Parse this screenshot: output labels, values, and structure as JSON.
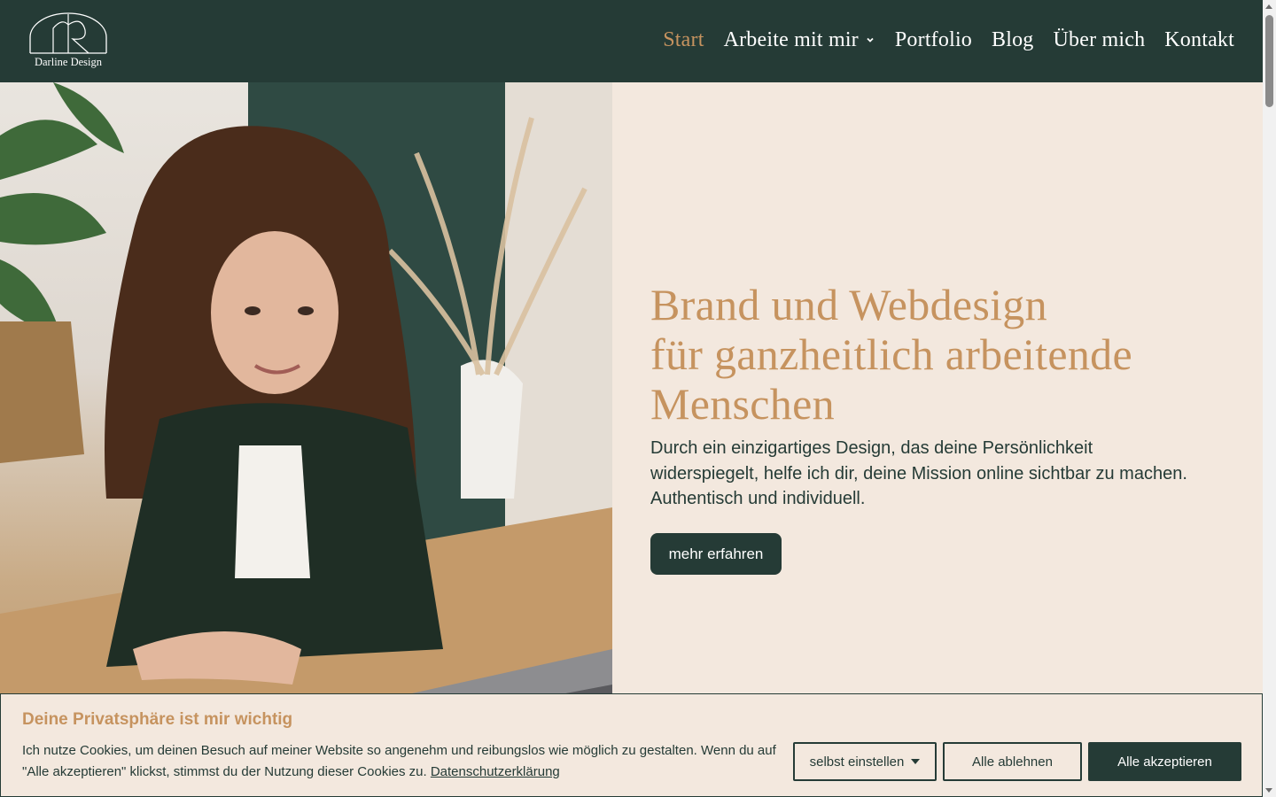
{
  "header": {
    "logo_text": "Darline Design",
    "nav": [
      {
        "label": "Start",
        "active": true
      },
      {
        "label": "Arbeite mit mir",
        "has_dropdown": true
      },
      {
        "label": "Portfolio"
      },
      {
        "label": "Blog"
      },
      {
        "label": "Über mich"
      },
      {
        "label": "Kontakt"
      }
    ]
  },
  "hero": {
    "headline_line1": "Brand und Webdesign",
    "headline_line2": "für ganzheitlich arbeitende",
    "headline_line3": "Menschen",
    "intro": "Durch ein einzigartiges Design, das deine Persönlichkeit widerspiegelt, helfe ich dir, deine Mission online sichtbar zu machen. Authentisch und individuell.",
    "cta_label": "mehr erfahren"
  },
  "cookie_banner": {
    "title": "Deine Privatsphäre ist mir wichtig",
    "text": "Ich nutze Cookies, um deinen Besuch auf meiner Website so angenehm und reibungslos wie möglich zu gestalten. Wenn du auf \"Alle akzeptieren\" klickst, stimmst du der Nutzung dieser Cookies zu.",
    "link_label": "Datenschutzerklärung",
    "select_label": "selbst einstellen",
    "reject_label": "Alle ablehnen",
    "accept_label": "Alle akzeptieren"
  },
  "colors": {
    "dark_green": "#253b36",
    "gold": "#c6935f",
    "cream": "#f3e8de"
  },
  "icons": {
    "nav_dropdown": "chevron-down-icon",
    "select_dropdown": "caret-down-icon"
  }
}
